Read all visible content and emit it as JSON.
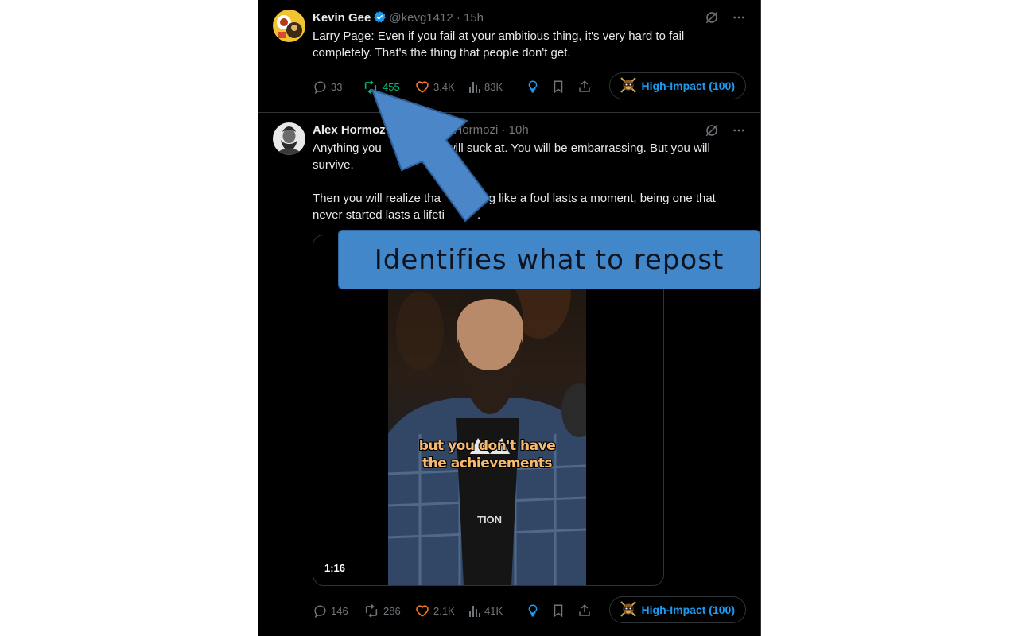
{
  "tweets": [
    {
      "author_name": "Kevin Gee",
      "verified": true,
      "meta": "@kevg1412 · 15h",
      "text": "Larry Page: Even if you fail at your ambitious thing, it's very hard to fail completely. That's the thing that people don't get.",
      "stats": {
        "replies": "33",
        "reposts": "455",
        "likes": "3.4K",
        "views": "83K"
      },
      "badge": "High-Impact (100)"
    },
    {
      "author_name": "Alex Hormoz",
      "meta": "xHormozi · 10h",
      "text_segments": [
        "Anything you",
        "ou will suck at. You will be embarrassing. But you will",
        "survive.",
        "Then you will realize tha",
        "ing like a fool lasts a moment, being one that",
        "never started lasts a lifeti",
        "."
      ],
      "video": {
        "duration": "1:16",
        "caption_line1": "but you don't have",
        "caption_line2": "the achievements",
        "logo_text": "TION"
      },
      "stats": {
        "replies": "146",
        "reposts": "286",
        "likes": "2.1K",
        "views": "41K"
      },
      "badge": "High-Impact (100)"
    }
  ],
  "annotation": {
    "callout_text": "Identifies what to repost",
    "color": "#4287c9"
  },
  "colors": {
    "background": "#000000",
    "text": "#e7e9ea",
    "muted": "#71767b",
    "accent": "#1d9bf0",
    "repost_active": "#00ba7c",
    "like": "#f4772e"
  }
}
